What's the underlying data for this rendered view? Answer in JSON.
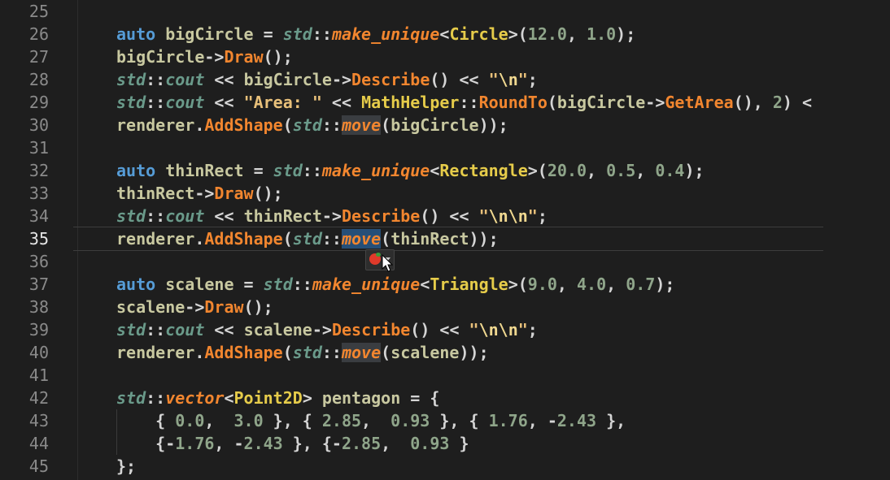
{
  "editor": {
    "current_line": "35",
    "lines": [
      {
        "n": "25",
        "code": ""
      },
      {
        "n": "26",
        "code": "auto bigCircle = std::make_unique<Circle>(12.0, 1.0);"
      },
      {
        "n": "27",
        "code": "bigCircle->Draw();"
      },
      {
        "n": "28",
        "code": "std::cout << bigCircle->Describe() << \"\\n\";"
      },
      {
        "n": "29",
        "code": "std::cout << \"Area: \" << MathHelper::RoundTo(bigCircle->GetArea(), 2) <"
      },
      {
        "n": "30",
        "code": "renderer.AddShape(std::move(bigCircle));"
      },
      {
        "n": "31",
        "code": ""
      },
      {
        "n": "32",
        "code": "auto thinRect = std::make_unique<Rectangle>(20.0, 0.5, 0.4);"
      },
      {
        "n": "33",
        "code": "thinRect->Draw();"
      },
      {
        "n": "34",
        "code": "std::cout << thinRect->Describe() << \"\\n\\n\";"
      },
      {
        "n": "35",
        "code": "renderer.AddShape(std::move(thinRect));"
      },
      {
        "n": "36",
        "code": ""
      },
      {
        "n": "37",
        "code": "auto scalene = std::make_unique<Triangle>(9.0, 4.0, 0.7);"
      },
      {
        "n": "38",
        "code": "scalene->Draw();"
      },
      {
        "n": "39",
        "code": "std::cout << scalene->Describe() << \"\\n\\n\";"
      },
      {
        "n": "40",
        "code": "renderer.AddShape(std::move(scalene));"
      },
      {
        "n": "41",
        "code": ""
      },
      {
        "n": "42",
        "code": "std::vector<Point2D> pentagon = {"
      },
      {
        "n": "43",
        "code": "    { 0.0,  3.0 }, { 2.85,  0.93 }, { 1.76, -2.43 },"
      },
      {
        "n": "44",
        "code": "    {-1.76, -2.43 }, {-2.85,  0.93 }"
      },
      {
        "n": "45",
        "code": "};"
      }
    ]
  },
  "lightbulb": {
    "icon": "lightbulb-quick-fix-icon"
  },
  "colors": {
    "background": "#1e1e1e",
    "keyword": "#569cd6",
    "function": "#f2862f",
    "type": "#e6cc4a",
    "number": "#8fa58a"
  }
}
